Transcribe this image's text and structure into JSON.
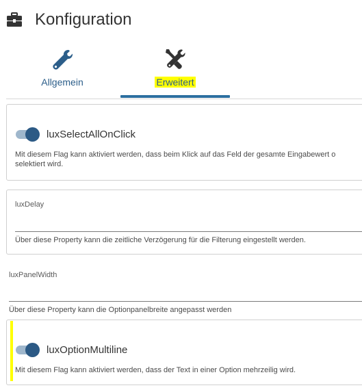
{
  "header": {
    "title": "Konfiguration",
    "icon": "toolbox-icon"
  },
  "tabs": [
    {
      "label": "Allgemein",
      "icon": "wrench-icon",
      "active": false
    },
    {
      "label": "Erweitert",
      "icon": "wrench-screwdriver-icon",
      "active": true
    }
  ],
  "settings": {
    "select_all": {
      "label": "luxSelectAllOnClick",
      "enabled": true,
      "hint_line1": "Mit diesem Flag kann aktiviert werden, dass beim Klick auf das Feld der gesamte Eingabewert o",
      "hint_line2": "selektiert wird."
    },
    "delay": {
      "label": "luxDelay",
      "value": "",
      "hint": "Über diese Property kann die zeitliche Verzögerung für die Filterung eingestellt werden."
    },
    "panel_width": {
      "label": "luxPanelWidth",
      "value": "",
      "hint": "Über diese Property kann die Optionpanelbreite angepasst werden"
    },
    "multiline": {
      "label": "luxOptionMultiline",
      "enabled": true,
      "hint": "Mit diesem Flag kann aktiviert werden, dass der Text in einer Option mehrzeilig wird."
    }
  },
  "colors": {
    "accent": "#2c6fa0",
    "toggle_knob": "#2c5a85",
    "toggle_track": "#9fb7cc",
    "highlight": "#ffff00"
  }
}
